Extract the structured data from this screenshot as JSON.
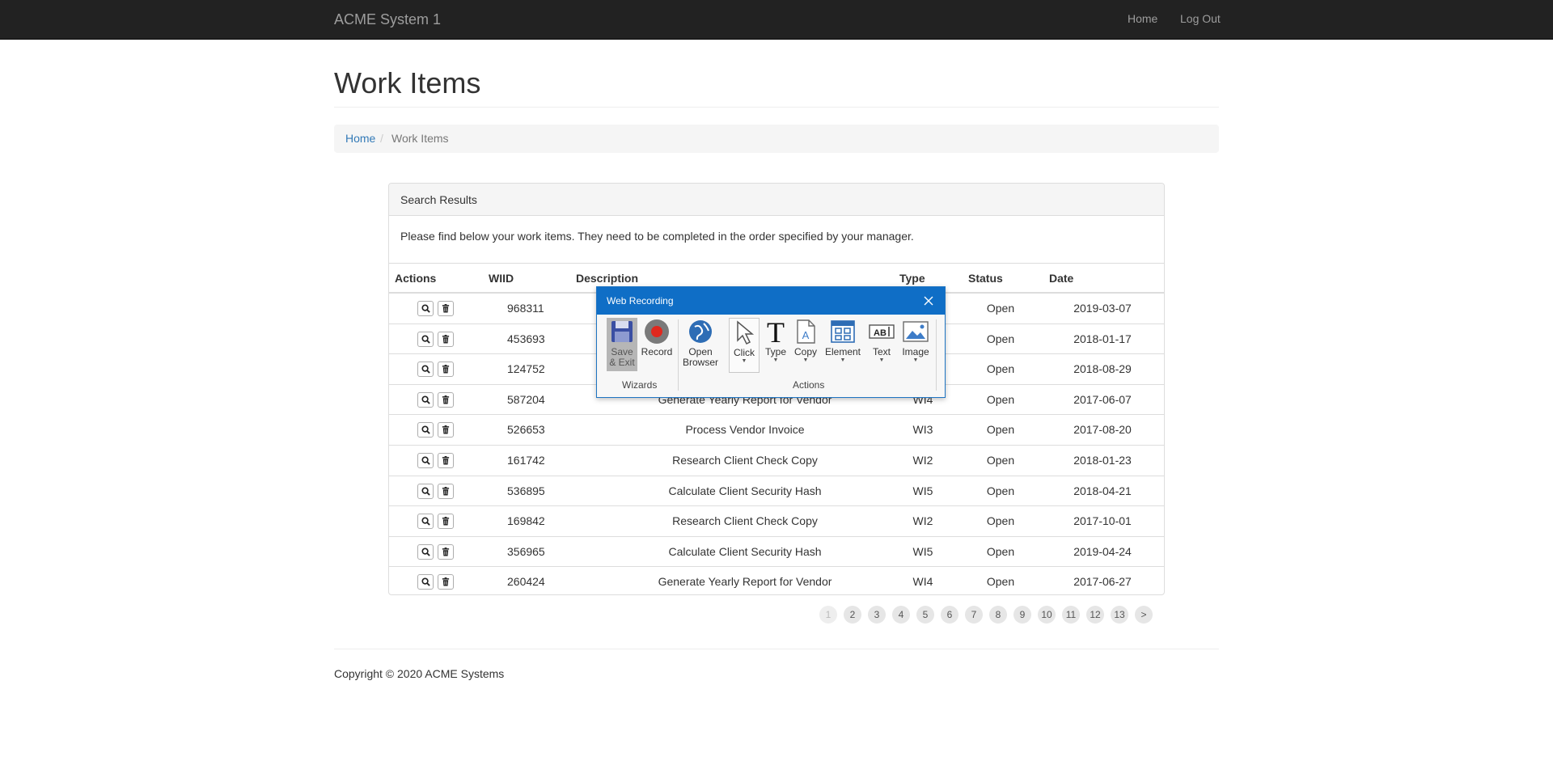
{
  "navbar": {
    "brand": "ACME System 1",
    "home": "Home",
    "logout": "Log Out"
  },
  "page": {
    "title": "Work Items"
  },
  "breadcrumb": {
    "home": "Home",
    "separator": "/",
    "current": "Work Items"
  },
  "panel": {
    "title": "Search Results",
    "intro": "Please find below your work items. They need to be completed in the order specified by your manager."
  },
  "table": {
    "headers": {
      "actions": "Actions",
      "wiid": "WIID",
      "description": "Description",
      "type": "Type",
      "status": "Status",
      "date": "Date"
    },
    "rows": [
      {
        "wiid": "968311",
        "description": "",
        "type": "",
        "status": "Open",
        "date": "2019-03-07"
      },
      {
        "wiid": "453693",
        "description": "",
        "type": "",
        "status": "Open",
        "date": "2018-01-17"
      },
      {
        "wiid": "124752",
        "description": "",
        "type": "",
        "status": "Open",
        "date": "2018-08-29"
      },
      {
        "wiid": "587204",
        "description": "Generate Yearly Report for Vendor",
        "type": "WI4",
        "status": "Open",
        "date": "2017-06-07"
      },
      {
        "wiid": "526653",
        "description": "Process Vendor Invoice",
        "type": "WI3",
        "status": "Open",
        "date": "2017-08-20"
      },
      {
        "wiid": "161742",
        "description": "Research Client Check Copy",
        "type": "WI2",
        "status": "Open",
        "date": "2018-01-23"
      },
      {
        "wiid": "536895",
        "description": "Calculate Client Security Hash",
        "type": "WI5",
        "status": "Open",
        "date": "2018-04-21"
      },
      {
        "wiid": "169842",
        "description": "Research Client Check Copy",
        "type": "WI2",
        "status": "Open",
        "date": "2017-10-01"
      },
      {
        "wiid": "356965",
        "description": "Calculate Client Security Hash",
        "type": "WI5",
        "status": "Open",
        "date": "2019-04-24"
      },
      {
        "wiid": "260424",
        "description": "Generate Yearly Report for Vendor",
        "type": "WI4",
        "status": "Open",
        "date": "2017-06-27"
      }
    ]
  },
  "pagination": {
    "pages": [
      "1",
      "2",
      "3",
      "4",
      "5",
      "6",
      "7",
      "8",
      "9",
      "10",
      "11",
      "12",
      "13"
    ],
    "next": ">",
    "current": "1"
  },
  "footer": {
    "copyright": "Copyright © 2020 ACME Systems"
  },
  "recorder": {
    "title": "Web Recording",
    "tools": {
      "save": "Save & Exit",
      "record": "Record",
      "open_browser": "Open Browser",
      "click": "Click",
      "type": "Type",
      "copy": "Copy",
      "element": "Element",
      "text": "Text",
      "image": "Image"
    },
    "groups": {
      "wizards": "Wizards",
      "actions": "Actions"
    }
  },
  "icons": {
    "row_view": "search-icon",
    "row_delete": "trash-icon",
    "close": "close-icon"
  },
  "colors": {
    "navbar": "#222222",
    "link": "#337ab7",
    "dialog_title": "#0f6ec6",
    "record": "#e0281e"
  }
}
